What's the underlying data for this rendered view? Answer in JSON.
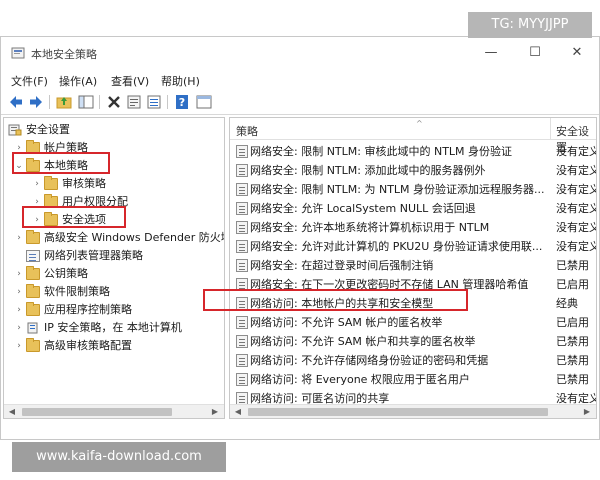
{
  "window": {
    "title": "本地安全策略"
  },
  "window_controls": {
    "minimize": "—",
    "maximize": "☐",
    "close": "✕"
  },
  "menu": [
    "文件(F)",
    "操作(A)",
    "查看(V)",
    "帮助(H)"
  ],
  "toolbar": {
    "icons": [
      "back-icon",
      "forward-icon",
      "up-folder-icon",
      "show-tree-icon",
      "delete-icon",
      "properties-icon",
      "export-list-icon",
      "help-icon",
      "console-icon"
    ]
  },
  "tree": {
    "items": [
      {
        "label": "安全设置",
        "level": 0,
        "expanded": true,
        "icon": "security-settings-icon"
      },
      {
        "label": "帐户策略",
        "level": 1,
        "expanded": false,
        "icon": "folder-icon"
      },
      {
        "label": "本地策略",
        "level": 1,
        "expanded": true,
        "icon": "folder-icon"
      },
      {
        "label": "审核策略",
        "level": 2,
        "expanded": false,
        "icon": "folder-icon"
      },
      {
        "label": "用户权限分配",
        "level": 2,
        "expanded": false,
        "icon": "folder-icon"
      },
      {
        "label": "安全选项",
        "level": 2,
        "expanded": false,
        "icon": "folder-icon",
        "selected": true
      },
      {
        "label": "高级安全 Windows Defender 防火墙",
        "level": 1,
        "expanded": false,
        "icon": "folder-icon"
      },
      {
        "label": "网络列表管理器策略",
        "level": 1,
        "expanded": false,
        "icon": "doc-icon"
      },
      {
        "label": "公钥策略",
        "level": 1,
        "expanded": false,
        "icon": "folder-icon"
      },
      {
        "label": "软件限制策略",
        "level": 1,
        "expanded": false,
        "icon": "folder-icon"
      },
      {
        "label": "应用程序控制策略",
        "level": 1,
        "expanded": false,
        "icon": "folder-icon"
      },
      {
        "label": "IP 安全策略，在 本地计算机",
        "level": 1,
        "expanded": false,
        "icon": "ip-security-icon"
      },
      {
        "label": "高级审核策略配置",
        "level": 1,
        "expanded": false,
        "icon": "folder-icon"
      }
    ]
  },
  "table": {
    "columns": [
      "策略",
      "安全设置"
    ],
    "rows": [
      {
        "name": "网络安全: 限制 NTLM: 审核此域中的 NTLM 身份验证",
        "setting": "没有定义"
      },
      {
        "name": "网络安全: 限制 NTLM: 添加此域中的服务器例外",
        "setting": "没有定义"
      },
      {
        "name": "网络安全: 限制 NTLM: 为 NTLM 身份验证添加远程服务器...",
        "setting": "没有定义"
      },
      {
        "name": "网络安全: 允许 LocalSystem NULL 会话回退",
        "setting": "没有定义"
      },
      {
        "name": "网络安全: 允许本地系统将计算机标识用于 NTLM",
        "setting": "没有定义"
      },
      {
        "name": "网络安全: 允许对此计算机的 PKU2U 身份验证请求使用联...",
        "setting": "没有定义"
      },
      {
        "name": "网络安全: 在超过登录时间后强制注销",
        "setting": "已禁用"
      },
      {
        "name": "网络安全: 在下一次更改密码时不存储 LAN 管理器哈希值",
        "setting": "已启用"
      },
      {
        "name": "网络访问: 本地帐户的共享和安全模型",
        "setting": "经典"
      },
      {
        "name": "网络访问: 不允许 SAM 帐户的匿名枚举",
        "setting": "已启用"
      },
      {
        "name": "网络访问: 不允许 SAM 帐户和共享的匿名枚举",
        "setting": "已禁用"
      },
      {
        "name": "网络访问: 不允许存储网络身份验证的密码和凭据",
        "setting": "已禁用"
      },
      {
        "name": "网络访问: 将 Everyone 权限应用于匿名用户",
        "setting": "已禁用"
      },
      {
        "name": "网络访问: 可匿名访问的共享",
        "setting": "没有定义"
      }
    ]
  },
  "watermarks": {
    "top_right": "TG: MYYJJPP",
    "bottom_left": "www.kaifa-download.com"
  },
  "colors": {
    "highlight": "#d6262b",
    "folder": "#e8c15a",
    "accent_blue": "#2f6fc6"
  }
}
